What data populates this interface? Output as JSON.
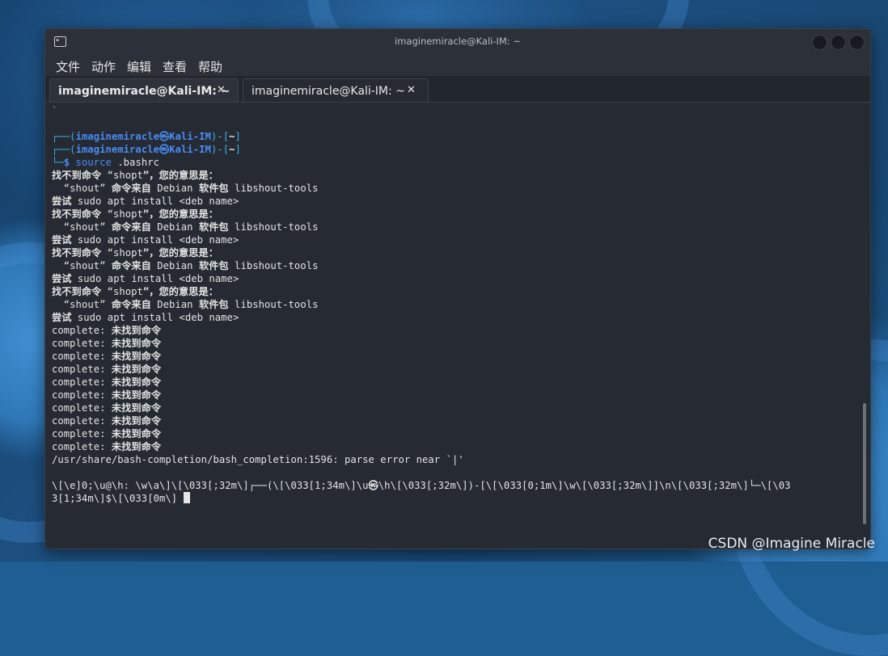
{
  "window": {
    "title": "imaginemiracle@Kali-IM: ~"
  },
  "menu": [
    "文件",
    "动作",
    "编辑",
    "查看",
    "帮助"
  ],
  "tabs": [
    {
      "label": "imaginemiracle@Kali-IM: ~",
      "close": "✕",
      "active": true
    },
    {
      "label": "imaginemiracle@Kali-IM: ~",
      "close": "✕",
      "active": false
    }
  ],
  "terminal": {
    "lines": [
      {
        "text": "`",
        "kind": "muted"
      },
      {
        "text": "",
        "kind": "blank"
      },
      {
        "text": "┌──(imaginemiracle㉿Kali-IM)-[~]",
        "kind": "prompt"
      },
      {
        "text": "┌──(imaginemiracle㉿Kali-IM)-[~]",
        "kind": "prompt"
      },
      {
        "text": "└─$ source .bashrc",
        "kind": "command"
      },
      {
        "text": "找不到命令 “shopt”，您的意思是：",
        "kind": "plain"
      },
      {
        "text": "  “shout” 命令来自 Debian 软件包 libshout-tools",
        "kind": "plain"
      },
      {
        "text": "尝试 sudo apt install <deb name>",
        "kind": "plain"
      },
      {
        "text": "找不到命令 “shopt”，您的意思是：",
        "kind": "plain"
      },
      {
        "text": "  “shout” 命令来自 Debian 软件包 libshout-tools",
        "kind": "plain"
      },
      {
        "text": "尝试 sudo apt install <deb name>",
        "kind": "plain"
      },
      {
        "text": "找不到命令 “shopt”，您的意思是：",
        "kind": "plain"
      },
      {
        "text": "  “shout” 命令来自 Debian 软件包 libshout-tools",
        "kind": "plain"
      },
      {
        "text": "尝试 sudo apt install <deb name>",
        "kind": "plain"
      },
      {
        "text": "找不到命令 “shopt”，您的意思是：",
        "kind": "plain"
      },
      {
        "text": "  “shout” 命令来自 Debian 软件包 libshout-tools",
        "kind": "plain"
      },
      {
        "text": "尝试 sudo apt install <deb name>",
        "kind": "plain"
      },
      {
        "text": "complete: 未找到命令",
        "kind": "plain"
      },
      {
        "text": "complete: 未找到命令",
        "kind": "plain"
      },
      {
        "text": "complete: 未找到命令",
        "kind": "plain"
      },
      {
        "text": "complete: 未找到命令",
        "kind": "plain"
      },
      {
        "text": "complete: 未找到命令",
        "kind": "plain"
      },
      {
        "text": "complete: 未找到命令",
        "kind": "plain"
      },
      {
        "text": "complete: 未找到命令",
        "kind": "plain"
      },
      {
        "text": "complete: 未找到命令",
        "kind": "plain"
      },
      {
        "text": "complete: 未找到命令",
        "kind": "plain"
      },
      {
        "text": "complete: 未找到命令",
        "kind": "plain"
      },
      {
        "text": "/usr/share/bash-completion/bash_completion:1596: parse error near `|'",
        "kind": "plain"
      },
      {
        "text": "",
        "kind": "blank"
      },
      {
        "text": "\\[\\e]0;\\u@\\h: \\w\\a\\]\\[\\033[;32m\\]┌──(\\[\\033[1;34m\\]\\u㉿\\h\\[\\033[;32m\\])-[\\[\\033[0;1m\\]\\w\\[\\033[;32m\\]]\\n\\[\\033[;32m\\]└─\\[\\03",
        "kind": "plain"
      },
      {
        "text": "3[1;34m\\]$\\[\\033[0m\\] ",
        "kind": "cursor"
      }
    ]
  },
  "watermark": "CSDN @Imagine Miracle"
}
